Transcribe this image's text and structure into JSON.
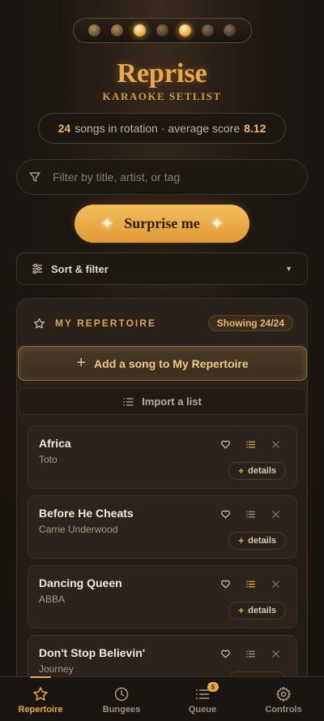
{
  "app": {
    "title": "Reprise",
    "tagline": "KARAOKE SETLIST"
  },
  "marquee": {
    "bulbs": [
      "dim",
      "dim",
      "on",
      "off",
      "on",
      "off",
      "off"
    ]
  },
  "stats": {
    "song_count": "24",
    "middle_text": "songs in rotation · average score",
    "average_score": "8.12"
  },
  "filter": {
    "placeholder": "Filter by title, artist, or tag",
    "value": "",
    "icon": "filter-icon"
  },
  "surprise": {
    "label": "Surprise me",
    "sparkle": "✦"
  },
  "sort": {
    "label": "Sort & filter",
    "caret": "▼"
  },
  "repertoire": {
    "title": "MY REPERTOIRE",
    "showing": "Showing 24/24",
    "add_label": "Add a song to My Repertoire",
    "import_label": "Import a list",
    "details_label": "details",
    "songs": [
      {
        "title": "Africa",
        "artist": "Toto",
        "queued": true
      },
      {
        "title": "Before He Cheats",
        "artist": "Carrie Underwood",
        "queued": false
      },
      {
        "title": "Dancing Queen",
        "artist": "ABBA",
        "queued": true
      },
      {
        "title": "Don't Stop Believin'",
        "artist": "Journey",
        "queued": false
      }
    ]
  },
  "nav": {
    "tabs": [
      {
        "label": "Repertoire",
        "icon": "star-icon",
        "active": true
      },
      {
        "label": "Bungees",
        "icon": "clock-icon",
        "active": false
      },
      {
        "label": "Queue",
        "icon": "list-icon",
        "active": false,
        "badge": "5"
      },
      {
        "label": "Controls",
        "icon": "gear-icon",
        "active": false
      }
    ]
  },
  "colors": {
    "accent": "#e9a94a",
    "background": "#1e1812",
    "card": "#2c241c"
  }
}
